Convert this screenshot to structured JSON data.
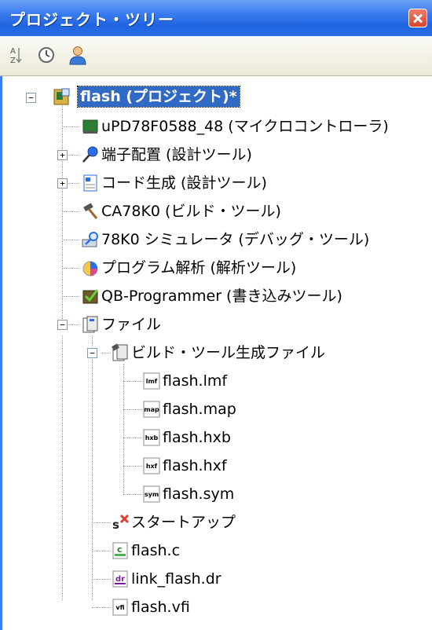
{
  "panel": {
    "title": "プロジェクト・ツリー"
  },
  "toolbar": {
    "buttons": [
      {
        "icon": "sort-az-icon"
      },
      {
        "icon": "property-icon"
      },
      {
        "icon": "user-icon"
      }
    ]
  },
  "tree": {
    "root": {
      "label": "flash (プロジェクト)*",
      "icon": "project-icon",
      "expanded": true
    },
    "microcontroller": {
      "label": "uPD78F0588_48 (マイクロコントローラ)",
      "icon": "chip-icon"
    },
    "pin_config": {
      "label": "端子配置 (設計ツール)",
      "icon": "pin-tool-icon",
      "expanded": false
    },
    "code_gen": {
      "label": "コード生成 (設計ツール)",
      "icon": "codegen-icon",
      "expanded": false
    },
    "build_tool": {
      "label": "CA78K0 (ビルド・ツール)",
      "icon": "hammer-icon"
    },
    "debug_tool": {
      "label": "78K0 シミュレータ (デバッグ・ツール)",
      "icon": "debug-icon"
    },
    "analysis_tool": {
      "label": "プログラム解析 (解析ツール)",
      "icon": "analysis-icon"
    },
    "programmer": {
      "label": "QB-Programmer (書き込みツール)",
      "icon": "programmer-icon"
    },
    "files": {
      "label": "ファイル",
      "icon": "folder-icon",
      "expanded": true
    },
    "build_generated": {
      "label": "ビルド・ツール生成ファイル",
      "icon": "folder-build-icon",
      "expanded": true
    },
    "generated_files": [
      {
        "label": "flash.lmf",
        "icon": "lmf-file-icon",
        "badge": "lmf"
      },
      {
        "label": "flash.map",
        "icon": "map-file-icon",
        "badge": "map"
      },
      {
        "label": "flash.hxb",
        "icon": "hxb-file-icon",
        "badge": "hxb"
      },
      {
        "label": "flash.hxf",
        "icon": "hxf-file-icon",
        "badge": "hxf"
      },
      {
        "label": "flash.sym",
        "icon": "sym-file-icon",
        "badge": "sym"
      }
    ],
    "startup": {
      "label": "スタートアップ",
      "icon": "startup-icon"
    },
    "source_files": [
      {
        "label": "flash.c",
        "icon": "c-file-icon",
        "badge": "c"
      },
      {
        "label": "link_flash.dr",
        "icon": "dr-file-icon",
        "badge": "dr"
      },
      {
        "label": "flash.vfi",
        "icon": "vfi-file-icon",
        "badge": "vfi"
      }
    ]
  },
  "colors": {
    "titlebar": "#3d7ff0",
    "selection": "#316ac5",
    "toolbar": "#ece9d8"
  }
}
